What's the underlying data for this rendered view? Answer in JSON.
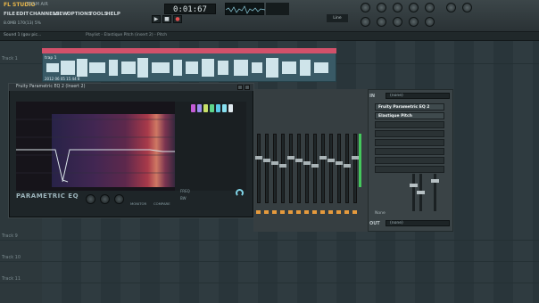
{
  "app": {
    "logo": "FL STUDIO",
    "edition": "TEAM AiR"
  },
  "menu": [
    "FILE",
    "EDIT",
    "CHANNELS",
    "VIEW",
    "OPTIONS",
    "TOOLS",
    "HELP"
  ],
  "info_line": "8.0MB  170(13)  5%",
  "transport": {
    "time": "0:01:67",
    "play_icon": "play-icon",
    "stop_icon": "stop-icon",
    "record_icon": "record-icon"
  },
  "line_label": "Line",
  "toolbar2": {
    "pattern_label": "Sound 1 (gov pic...",
    "playlist_title": "Playlist - Elastique Pitch (insert 2) - Pitch"
  },
  "playlist": {
    "tracks": [
      {
        "label": "Track 1"
      },
      {
        "label": "Track 9"
      },
      {
        "label": "Track 10"
      },
      {
        "label": "Track 11"
      }
    ],
    "clip": {
      "label": "trap 1",
      "footer": "2012 06 05 15 44 8"
    }
  },
  "eq": {
    "title": "Fruity Parametric EQ 2 (Insert 2)",
    "name": "PARAMETRIC EQ",
    "bands_colors": [
      "#c45cd6",
      "#9c8cf0",
      "#c8e06a",
      "#5fd48a",
      "#5ac8e8",
      "#88e0f0",
      "#dfe9ee"
    ],
    "controls": {
      "freq": "FREQ",
      "bw": "BW",
      "monitor": "MONITOR",
      "compare": "COMPARE"
    }
  },
  "fx": {
    "in_label": "IN",
    "in_value": "(none)",
    "slots": [
      {
        "label": "Fruity Parametric EQ 2",
        "active": true
      },
      {
        "label": "Elastique Pitch",
        "active": true
      },
      {
        "label": "",
        "active": false
      },
      {
        "label": "",
        "active": false
      },
      {
        "label": "",
        "active": false
      },
      {
        "label": "",
        "active": false
      },
      {
        "label": "",
        "active": false
      },
      {
        "label": "",
        "active": false
      }
    ],
    "none_label": "None",
    "out_label": "OUT",
    "out_value": "(none)"
  }
}
